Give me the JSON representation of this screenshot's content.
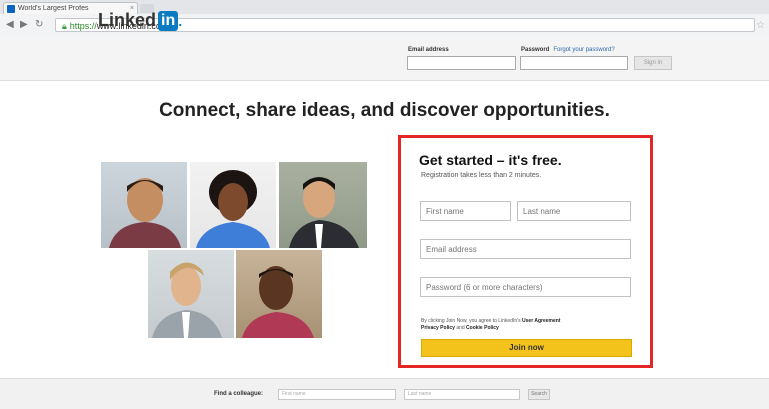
{
  "browser": {
    "tab_title": "World's Largest Profes",
    "tab_close": "×",
    "url_scheme": "https://",
    "url_host": "www.linkedin.com",
    "nav": {
      "back": "◀",
      "forward": "▶",
      "reload": "↻"
    },
    "star": "☆"
  },
  "header": {
    "logo_text": "Linked",
    "logo_in": "in",
    "logo_dot": ".",
    "email_label": "Email address",
    "password_label": "Password",
    "forgot_link": "Forgot your password?",
    "signin_label": "Sign in"
  },
  "main": {
    "headline": "Connect, share ideas, and discover opportunities."
  },
  "signup": {
    "title": "Get started – it's free.",
    "subtitle": "Registration takes less than 2 minutes.",
    "first_name_placeholder": "First name",
    "last_name_placeholder": "Last name",
    "email_placeholder": "Email address",
    "password_placeholder": "Password (6 or more characters)",
    "terms_prefix": "By clicking Join Now, you agree to LinkedIn's",
    "terms_user_agreement": "User Agreement",
    "terms_privacy": "Privacy Policy",
    "terms_and": "and",
    "terms_cookie": "Cookie Policy",
    "join_label": "Join now"
  },
  "footer": {
    "find_label": "Find a colleague:",
    "first_placeholder": "First name",
    "last_placeholder": "Last name",
    "search_label": "Search"
  },
  "colors": {
    "linkedin_blue": "#0a7bc0",
    "highlight_red": "#e52626",
    "join_yellow": "#f3c31b"
  }
}
